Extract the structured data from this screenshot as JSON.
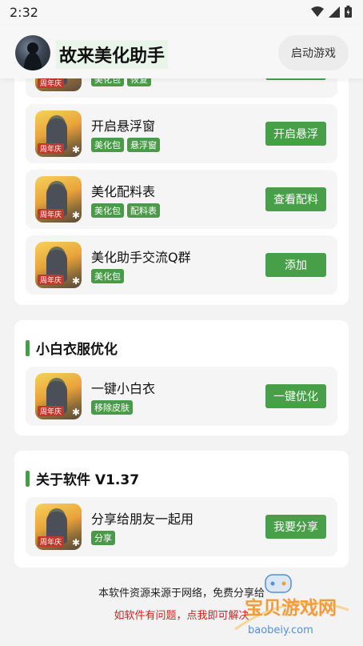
{
  "status_bar": {
    "time": "2:32",
    "icons": [
      "wifi-icon",
      "signal-icon",
      "battery-icon"
    ]
  },
  "app_bar": {
    "title": "故来美化助手",
    "launch_button": "启动游戏"
  },
  "section1": {
    "partial_item": {
      "tags": [
        "美化包",
        "恢复"
      ],
      "badge": "周年庆"
    },
    "items": [
      {
        "name": "开启悬浮窗",
        "tags": [
          "美化包",
          "悬浮窗"
        ],
        "button": "开启悬浮",
        "badge": "周年庆"
      },
      {
        "name": "美化配料表",
        "tags": [
          "美化包",
          "配料表"
        ],
        "button": "查看配料",
        "badge": "周年庆"
      },
      {
        "name": "美化助手交流Q群",
        "tags": [
          "美化包"
        ],
        "button": "添加",
        "badge": "周年庆"
      }
    ]
  },
  "section2": {
    "title": "小白衣服优化",
    "items": [
      {
        "name": "一键小白衣",
        "tags": [
          "移除皮肤"
        ],
        "button": "一键优化",
        "badge": "周年庆"
      }
    ]
  },
  "section3": {
    "title": "关于软件 V1.37",
    "items": [
      {
        "name": "分享给朋友一起用",
        "tags": [
          "分享"
        ],
        "button": "我要分享",
        "badge": "周年庆"
      }
    ]
  },
  "footer": {
    "line1": "本软件资源来源于网络，免费分享给",
    "line2": "如软件有问题，点我即可解决"
  },
  "watermark": {
    "text": "宝贝游戏网",
    "url_text": "baobeiy.com"
  },
  "colors": {
    "accent": "#47a047",
    "warning_text": "#d32020"
  }
}
